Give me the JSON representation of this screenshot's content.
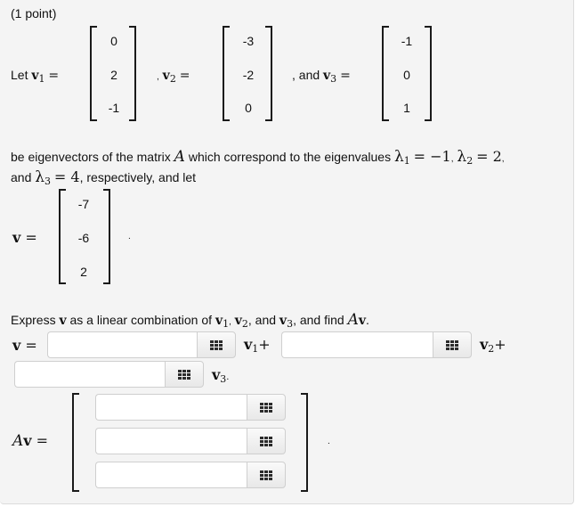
{
  "header": {
    "points": "(1 point)"
  },
  "intro": {
    "let": "Let",
    "v1_label": "v",
    "v1_sub": "1",
    "v2_label": "v",
    "v2_sub": "2",
    "v3_label": "v",
    "v3_sub": "3",
    "equals": "=",
    "comma_v2": ",",
    "and_text": ", and",
    "v1": [
      "0",
      "2",
      "-1"
    ],
    "v2": [
      "-3",
      "-2",
      "0"
    ],
    "v3": [
      "-1",
      "0",
      "1"
    ]
  },
  "eigen": {
    "line1_a": "be eigenvectors of the matrix",
    "matrix_name": "A",
    "line1_b": "which correspond to the eigenvalues",
    "lambda": "λ",
    "l1_sub": "1",
    "l1_val": "= −1",
    "l2_sub": "2",
    "l2_val": "= 2",
    "line2_a": "and",
    "l3_sub": "3",
    "l3_val": "= 4",
    "line2_b": ", respectively, and let"
  },
  "vector_v": {
    "label": "v",
    "equals": "=",
    "values": [
      "-7",
      "-6",
      "2"
    ],
    "period": "."
  },
  "question": {
    "text_a": "Express",
    "v": "v",
    "text_b": "as a linear combination of",
    "v1_sub": "1",
    "v2_sub": "2",
    "v3_sub": "3",
    "comma": ",",
    "and1": ", and",
    "text_c": ", and find",
    "Av_A": "A",
    "Av_v": "v",
    "period": "."
  },
  "answers": {
    "v_equals": "= ",
    "v1_plus": "+",
    "v2_plus": "+",
    "v3_period": ".",
    "coef1": "",
    "coef2": "",
    "coef3": "",
    "Av_label_A": "A",
    "Av_label_v": "v",
    "Av_equals": "=",
    "Av": [
      "",
      "",
      ""
    ],
    "Av_period": "."
  },
  "icons": {
    "palette": "grid-icon"
  }
}
